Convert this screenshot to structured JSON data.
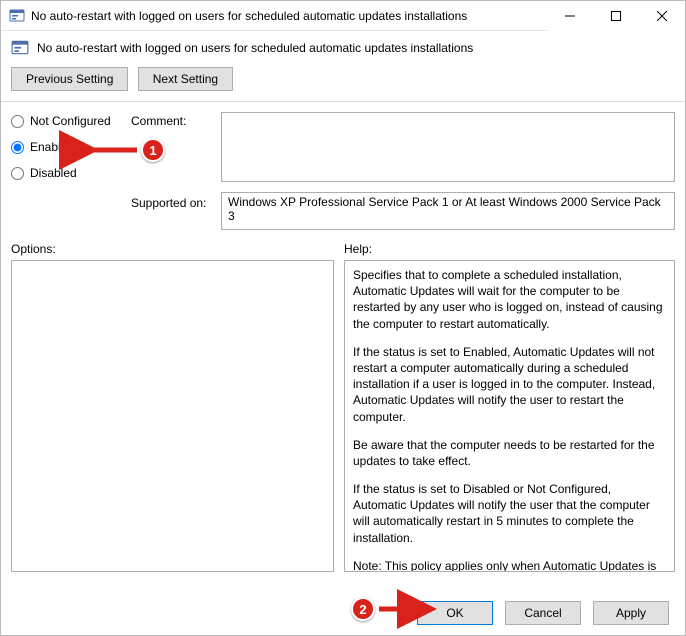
{
  "window": {
    "title": "No auto-restart with logged on users for scheduled automatic updates installations",
    "subtitle": "No auto-restart with logged on users for scheduled automatic updates installations"
  },
  "nav": {
    "previous": "Previous Setting",
    "next": "Next Setting"
  },
  "radios": {
    "not_configured": "Not Configured",
    "enabled": "Enabled",
    "disabled": "Disabled",
    "selected": "enabled"
  },
  "labels": {
    "comment": "Comment:",
    "supported": "Supported on:",
    "options": "Options:",
    "help": "Help:"
  },
  "comment": "",
  "supported": "Windows XP Professional Service Pack 1 or At least Windows 2000 Service Pack 3",
  "help_paragraphs": [
    "Specifies that to complete a scheduled installation, Automatic Updates will wait for the computer to be restarted by any user who is logged on, instead of causing the computer to restart automatically.",
    "If the status is set to Enabled, Automatic Updates will not restart a computer automatically during a scheduled installation if a user is logged in to the computer. Instead, Automatic Updates will notify the user to restart the computer.",
    "Be aware that the computer needs to be restarted for the updates to take effect.",
    "If the status is set to Disabled or Not Configured, Automatic Updates will notify the user that the computer will automatically restart in 5 minutes to complete the installation.",
    "Note: This policy applies only when Automatic Updates is configured to perform scheduled installations of updates. If the"
  ],
  "footer": {
    "ok": "OK",
    "cancel": "Cancel",
    "apply": "Apply"
  },
  "annotations": {
    "badge1": "1",
    "badge2": "2"
  }
}
